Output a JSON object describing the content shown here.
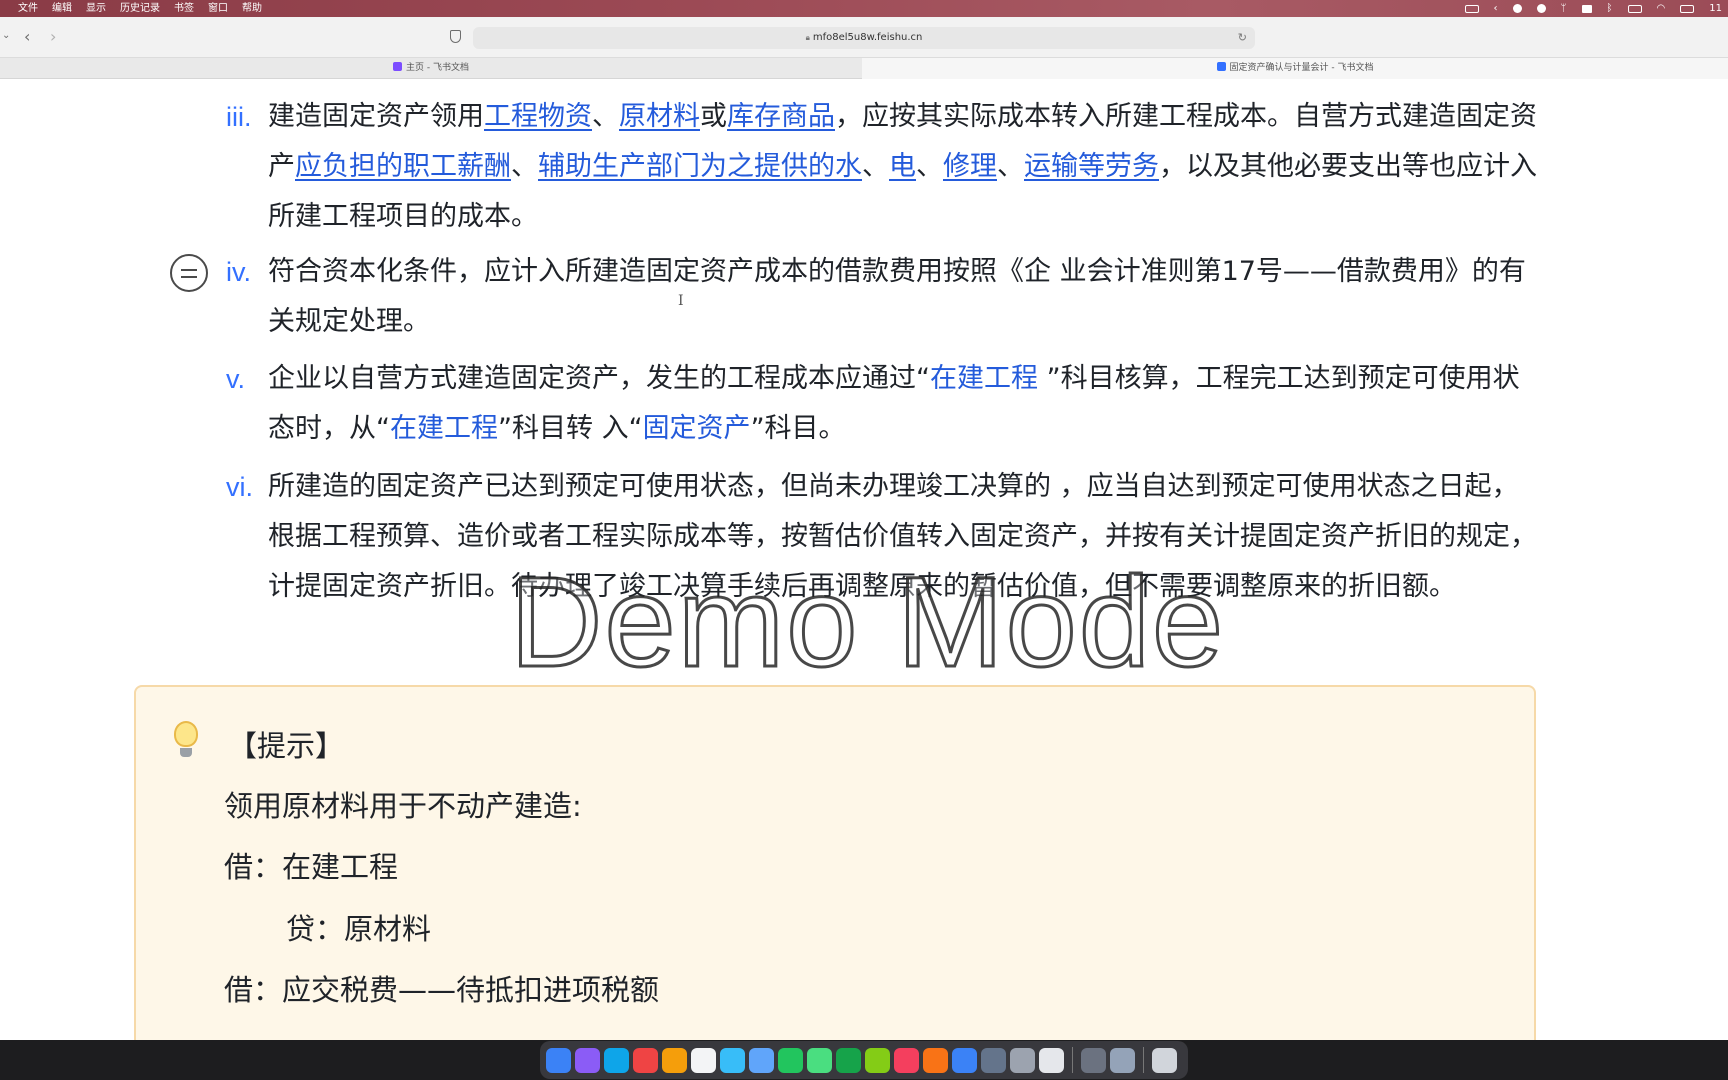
{
  "menubar": {
    "items": [
      "文件",
      "编辑",
      "显示",
      "历史记录",
      "书签",
      "窗口",
      "帮助"
    ],
    "clock": "11"
  },
  "browser": {
    "url": "mfo8el5u8w.feishu.cn",
    "tabs": [
      {
        "title": "主页 - 飞书文档",
        "active": false
      },
      {
        "title": "固定资产确认与计量会计 - 飞书文档",
        "active": true
      }
    ]
  },
  "document": {
    "items": [
      {
        "num": "iii.",
        "segments": [
          {
            "t": "建造固定资产领用"
          },
          {
            "t": "工程物资",
            "link": true
          },
          {
            "t": "、"
          },
          {
            "t": "原材料",
            "link": true
          },
          {
            "t": "或"
          },
          {
            "t": "库存商品",
            "link": true
          },
          {
            "t": "，应按其实际成本转入所建工程成本。自营方式建造固定资产"
          },
          {
            "t": "应负担的职工薪酬",
            "link": true
          },
          {
            "t": "、"
          },
          {
            "t": "辅助生产部门为之提供的水",
            "link": true
          },
          {
            "t": "、"
          },
          {
            "t": "电",
            "link": true
          },
          {
            "t": "、"
          },
          {
            "t": "修理",
            "link": true
          },
          {
            "t": "、"
          },
          {
            "t": "运输等劳务",
            "link": true
          },
          {
            "t": "，以及其他必要支出等也应计入所建工程项目的成本。"
          }
        ]
      },
      {
        "num": "iv.",
        "segments": [
          {
            "t": "符合资本化条件，应计入所建造固定资产成本的借款费用按照《企 业会计准则第17号——借款费用》的有关规定处理。"
          }
        ]
      },
      {
        "num": "v.",
        "segments": [
          {
            "t": "企业以自营方式建造固定资产，发生的工程成本应通过“"
          },
          {
            "t": "在建工程",
            "ref": true
          },
          {
            "t": " ”科目核算，工程完工达到预定可使用状态时，从“"
          },
          {
            "t": "在建工程",
            "ref": true
          },
          {
            "t": "”科目转 入“"
          },
          {
            "t": "固定资产",
            "ref": true
          },
          {
            "t": "”科目。"
          }
        ]
      },
      {
        "num": "vi.",
        "segments": [
          {
            "t": "所建造的固定资产已达到预定可使用状态，但尚未办理竣工决算的 ，应当自达到预定可使用状态之日起，根据工程预算、造价或者工程实际成本等，按暂估价值转入固定资产，并按有关计提固定资产折旧的规定，计提固定资产折旧。待办理了竣工决算手续后再调整原来的暂估价值，但不需要调整原来的折旧额。"
          }
        ]
      }
    ],
    "callout": {
      "title": "【提示】",
      "lines": [
        "领用原材料用于不动产建造:",
        "借：在建工程",
        "贷：原材料",
        "借：应交税费——待抵扣进项税额"
      ]
    }
  },
  "watermark": "Demo Mode",
  "dock": {
    "apps": [
      {
        "name": "finder",
        "color": "#3b82f6"
      },
      {
        "name": "launchpad",
        "color": "#8b5cf6"
      },
      {
        "name": "safari",
        "color": "#0ea5e9"
      },
      {
        "name": "chrome",
        "color": "#ef4444"
      },
      {
        "name": "photos",
        "color": "#f59e0b"
      },
      {
        "name": "calendar",
        "color": "#f3f4f6"
      },
      {
        "name": "telegram",
        "color": "#38bdf8"
      },
      {
        "name": "qq",
        "color": "#60a5fa"
      },
      {
        "name": "wechat",
        "color": "#22c55e"
      },
      {
        "name": "messages",
        "color": "#4ade80"
      },
      {
        "name": "play",
        "color": "#16a34a"
      },
      {
        "name": "pear",
        "color": "#84cc16"
      },
      {
        "name": "music",
        "color": "#f43f5e"
      },
      {
        "name": "game",
        "color": "#f97316"
      },
      {
        "name": "appstore",
        "color": "#3b82f6"
      },
      {
        "name": "preview",
        "color": "#64748b"
      },
      {
        "name": "settings",
        "color": "#9ca3af"
      },
      {
        "name": "slack",
        "color": "#e5e7eb"
      },
      {
        "name": "calculator",
        "color": "#6b7280"
      },
      {
        "name": "screen",
        "color": "#94a3b8"
      },
      {
        "name": "trash",
        "color": "#d1d5db"
      }
    ]
  }
}
